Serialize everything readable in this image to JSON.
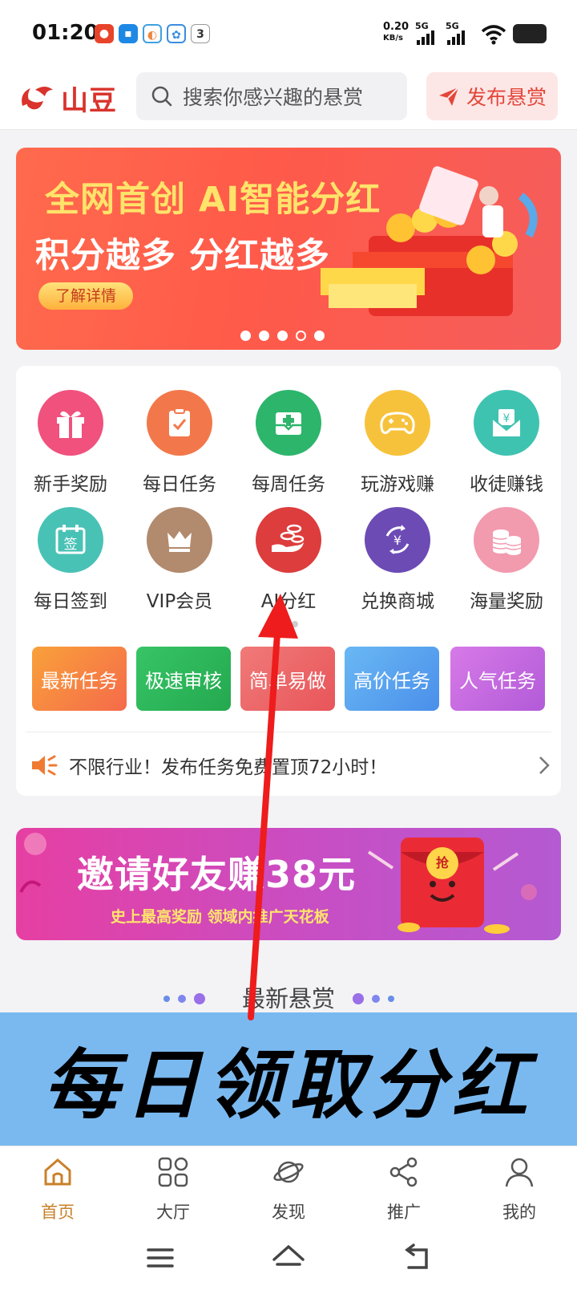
{
  "status_bar": {
    "time": "01:20",
    "net_speed": "0.20",
    "net_unit": "KB/s",
    "sim1": "5G",
    "sim2": "5G",
    "notification_badge": "3"
  },
  "header": {
    "logo_text": "山豆",
    "search_placeholder": "搜索你感兴趣的悬赏",
    "publish_label": "发布悬赏"
  },
  "banner": {
    "line1": "全网首创 AI智能分红",
    "line2": "积分越多 分红越多",
    "button": "了解详情",
    "slide_count": 5,
    "active_slide": 4
  },
  "features": [
    {
      "label": "新手奖励",
      "icon": "gift-icon",
      "color": "#f0517d"
    },
    {
      "label": "每日任务",
      "icon": "clipboard-icon",
      "color": "#f2784b"
    },
    {
      "label": "每周任务",
      "icon": "medical-box-icon",
      "color": "#2db56b"
    },
    {
      "label": "玩游戏赚",
      "icon": "gamepad-icon",
      "color": "#f7c23b"
    },
    {
      "label": "收徒赚钱",
      "icon": "money-envelope-icon",
      "color": "#3fc3b1"
    },
    {
      "label": "每日签到",
      "icon": "calendar-sign-icon",
      "color": "#49c2b6"
    },
    {
      "label": "VIP会员",
      "icon": "crown-icon",
      "color": "#b28a6d"
    },
    {
      "label": "AI分红",
      "icon": "hand-coins-icon",
      "color": "#dd3d3d"
    },
    {
      "label": "兑换商城",
      "icon": "yuan-exchange-icon",
      "color": "#6c4bb5"
    },
    {
      "label": "海量奖励",
      "icon": "coin-stack-icon",
      "color": "#f29aae"
    }
  ],
  "task_tags": [
    {
      "label": "最新任务",
      "from": "#f9a13a",
      "to": "#f56a4a"
    },
    {
      "label": "极速审核",
      "from": "#37c566",
      "to": "#24a84f"
    },
    {
      "label": "简单易做",
      "from": "#f07a78",
      "to": "#e8555a"
    },
    {
      "label": "高价任务",
      "from": "#6ab8f4",
      "to": "#4a8fea"
    },
    {
      "label": "人气任务",
      "from": "#d77ae8",
      "to": "#b25ad8"
    }
  ],
  "notice": {
    "text": "不限行业！发布任务免费置顶72小时！"
  },
  "invite_banner": {
    "title": "邀请好友赚38元",
    "subtitle": "史上最高奖励 领域内推广天花板",
    "envelope_char": "抢"
  },
  "section_title": "最新悬赏",
  "overlay_caption": "每日领取分红",
  "tabbar": [
    {
      "label": "首页",
      "icon": "home-icon",
      "active": true
    },
    {
      "label": "大厅",
      "icon": "grid-icon",
      "active": false
    },
    {
      "label": "发现",
      "icon": "planet-icon",
      "active": false
    },
    {
      "label": "推广",
      "icon": "share-icon",
      "active": false
    },
    {
      "label": "我的",
      "icon": "user-icon",
      "active": false
    }
  ],
  "colors": {
    "brand_red": "#d9332c",
    "accent_orange": "#c9812a",
    "arrow_red": "#ee1c1c",
    "overlay_blue": "#7ab9f0"
  }
}
